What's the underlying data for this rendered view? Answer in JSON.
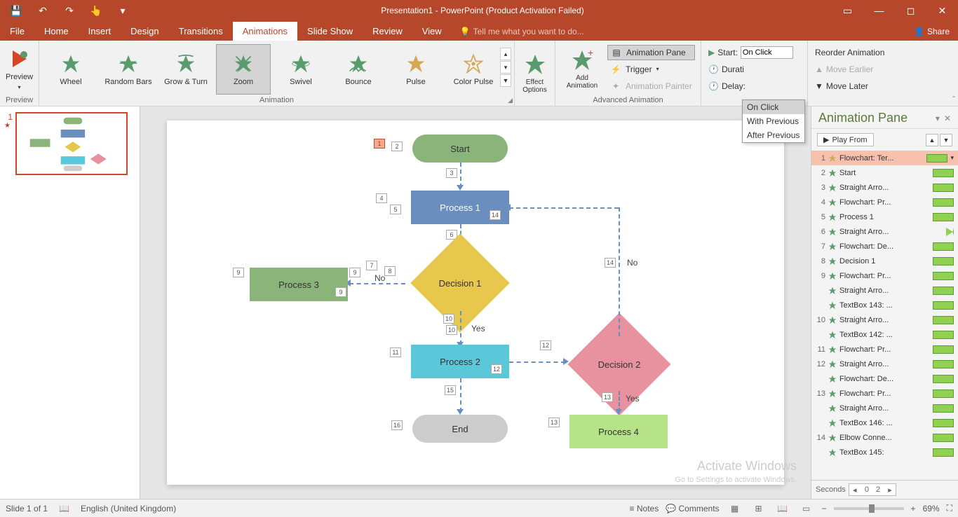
{
  "title": "Presentation1 - PowerPoint (Product Activation Failed)",
  "qat": {
    "save": "💾",
    "undo": "↶",
    "redo": "↷",
    "touch": "☝",
    "custom": "▾"
  },
  "tabs": [
    "File",
    "Home",
    "Insert",
    "Design",
    "Transitions",
    "Animations",
    "Slide Show",
    "Review",
    "View"
  ],
  "active_tab": "Animations",
  "tellme": "Tell me what you want to do...",
  "share": "Share",
  "ribbon": {
    "preview": {
      "label": "Preview",
      "group": "Preview"
    },
    "gallery": [
      {
        "label": "Wheel"
      },
      {
        "label": "Random Bars"
      },
      {
        "label": "Grow & Turn"
      },
      {
        "label": "Zoom",
        "selected": true
      },
      {
        "label": "Swivel"
      },
      {
        "label": "Bounce"
      },
      {
        "label": "Pulse"
      },
      {
        "label": "Color Pulse"
      }
    ],
    "animation_group": "Animation",
    "effect_options": "Effect Options",
    "add_animation": "Add Animation",
    "adv": {
      "pane": "Animation Pane",
      "trigger": "Trigger",
      "painter": "Animation Painter",
      "group": "Advanced Animation"
    },
    "timing": {
      "start_label": "Start:",
      "start_value": "On Click",
      "duration": "Durati",
      "delay": "Delay:",
      "options": [
        "On Click",
        "With Previous",
        "After Previous"
      ]
    },
    "reorder": {
      "title": "Reorder Animation",
      "earlier": "Move Earlier",
      "later": "Move Later"
    }
  },
  "slide": {
    "shapes": {
      "start": "Start",
      "process1": "Process 1",
      "process2": "Process 2",
      "process3": "Process 3",
      "process4": "Process 4",
      "decision1": "Decision 1",
      "decision2": "Decision 2",
      "end": "End",
      "yes": "Yes",
      "no": "No"
    },
    "tags": {
      "t1": "1",
      "t2": "2",
      "t3": "3",
      "t4": "4",
      "t5": "5",
      "t6": "6",
      "t7": "7",
      "t8": "8",
      "t9": "9",
      "t9b": "9",
      "t9c": "9",
      "t10a": "10",
      "t10b": "10",
      "t11": "11",
      "t12": "12",
      "t12b": "12",
      "t13": "13",
      "t13b": "13",
      "t14": "14",
      "t14b": "14",
      "t15": "15",
      "t16": "16"
    }
  },
  "anim_pane": {
    "title": "Animation Pane",
    "play": "Play From",
    "items": [
      {
        "n": "1",
        "label": "Flowchart: Ter...",
        "sel": true,
        "bar": "bar"
      },
      {
        "n": "2",
        "label": "Start",
        "bar": "bar"
      },
      {
        "n": "3",
        "label": "Straight Arro...",
        "bar": "bar"
      },
      {
        "n": "4",
        "label": "Flowchart: Pr...",
        "bar": "bar"
      },
      {
        "n": "5",
        "label": "Process 1",
        "bar": "bar"
      },
      {
        "n": "6",
        "label": "Straight Arro...",
        "bar": "tri"
      },
      {
        "n": "7",
        "label": "Flowchart: De...",
        "bar": "bar"
      },
      {
        "n": "8",
        "label": "Decision 1",
        "bar": "bar"
      },
      {
        "n": "9",
        "label": "Flowchart: Pr...",
        "bar": "bar"
      },
      {
        "n": "",
        "label": "Straight Arro...",
        "bar": "bar"
      },
      {
        "n": "",
        "label": "TextBox 143: ...",
        "bar": "bar"
      },
      {
        "n": "10",
        "label": "Straight Arro...",
        "bar": "bar"
      },
      {
        "n": "",
        "label": "TextBox 142: ...",
        "bar": "bar"
      },
      {
        "n": "11",
        "label": "Flowchart: Pr...",
        "bar": "bar"
      },
      {
        "n": "12",
        "label": "Straight Arro...",
        "bar": "bar"
      },
      {
        "n": "",
        "label": "Flowchart: De...",
        "bar": "bar"
      },
      {
        "n": "13",
        "label": "Flowchart: Pr...",
        "bar": "bar"
      },
      {
        "n": "",
        "label": "Straight Arro...",
        "bar": "bar"
      },
      {
        "n": "",
        "label": "TextBox 146: ...",
        "bar": "bar"
      },
      {
        "n": "14",
        "label": "Elbow Conne...",
        "bar": "bar"
      },
      {
        "n": "",
        "label": "TextBox 145:",
        "bar": "bar"
      }
    ],
    "seconds": "Seconds",
    "sec0": "0",
    "sec2": "2"
  },
  "status": {
    "slide": "Slide 1 of 1",
    "lang": "English (United Kingdom)",
    "notes": "Notes",
    "comments": "Comments",
    "zoom": "69%"
  },
  "thumb_num": "1",
  "watermark": {
    "title": "Activate Windows",
    "sub": "Go to Settings to activate Windows."
  }
}
